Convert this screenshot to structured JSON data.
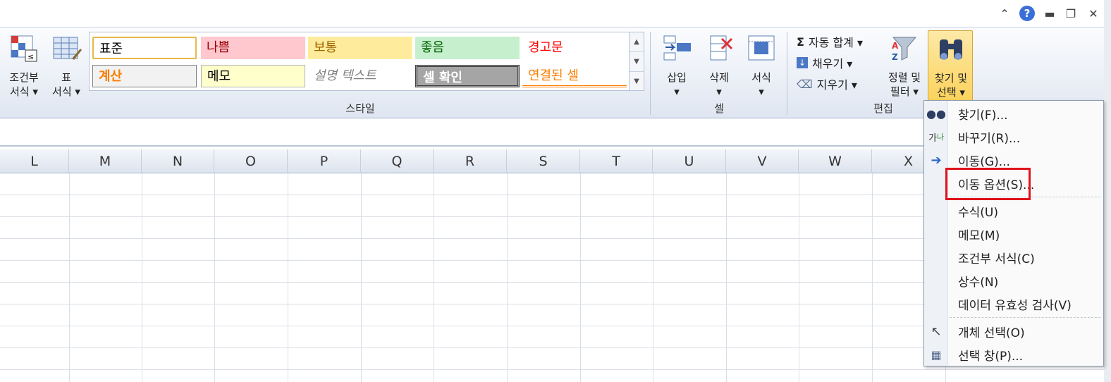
{
  "window": {
    "help_label": "?"
  },
  "ribbon": {
    "conditional_format": {
      "line1": "조건부",
      "line2": "서식 ▾"
    },
    "table_format": {
      "line1": "표",
      "line2": "서식 ▾"
    },
    "styles": {
      "group_label": "스타일",
      "cells": [
        {
          "label": "표준",
          "bg": "#ffffff",
          "color": "#000000"
        },
        {
          "label": "나쁨",
          "bg": "#ffc7ce",
          "color": "#9c0006"
        },
        {
          "label": "보통",
          "bg": "#ffeb9c",
          "color": "#9c6500"
        },
        {
          "label": "좋음",
          "bg": "#c6efce",
          "color": "#006100"
        },
        {
          "label": "경고문",
          "bg": "#ffffff",
          "color": "#ff0000"
        },
        {
          "label": "계산",
          "bg": "#f2f2f2",
          "color": "#fa7d00"
        },
        {
          "label": "메모",
          "bg": "#ffffcc",
          "color": "#000000"
        },
        {
          "label": "설명 텍스트",
          "bg": "#ffffff",
          "color": "#7f7f7f"
        },
        {
          "label": "셀 확인",
          "bg": "#a5a5a5",
          "color": "#ffffff"
        },
        {
          "label": "연결된 셀",
          "bg": "#ffffff",
          "color": "#fa7d00"
        }
      ]
    },
    "cells_group": {
      "group_label": "셀",
      "insert": "삽입",
      "delete": "삭제",
      "format": "서식"
    },
    "editing": {
      "group_label": "편집",
      "autosum": "자동 합계 ▾",
      "fill": "채우기 ▾",
      "clear": "지우기 ▾",
      "sort_line1": "정렬 및",
      "sort_line2": "필터 ▾",
      "find_line1": "찾기 및",
      "find_line2": "선택 ▾"
    }
  },
  "columns": [
    "L",
    "M",
    "N",
    "O",
    "P",
    "Q",
    "R",
    "S",
    "T",
    "U",
    "V",
    "W",
    "X"
  ],
  "menu": {
    "items": [
      {
        "label": "찾기(F)...",
        "icon": "binoculars-icon"
      },
      {
        "label": "바꾸기(R)...",
        "icon": "replace-icon"
      },
      {
        "label": "이동(G)...",
        "icon": "arrow-right-icon"
      },
      {
        "label": "이동 옵션(S)...",
        "icon": ""
      },
      {
        "label": "수식(U)",
        "icon": ""
      },
      {
        "label": "메모(M)",
        "icon": ""
      },
      {
        "label": "조건부 서식(C)",
        "icon": ""
      },
      {
        "label": "상수(N)",
        "icon": ""
      },
      {
        "label": "데이터 유효성 검사(V)",
        "icon": ""
      },
      {
        "label": "개체 선택(O)",
        "icon": "pointer-icon"
      },
      {
        "label": "선택 창(P)...",
        "icon": "selection-pane-icon"
      }
    ]
  }
}
